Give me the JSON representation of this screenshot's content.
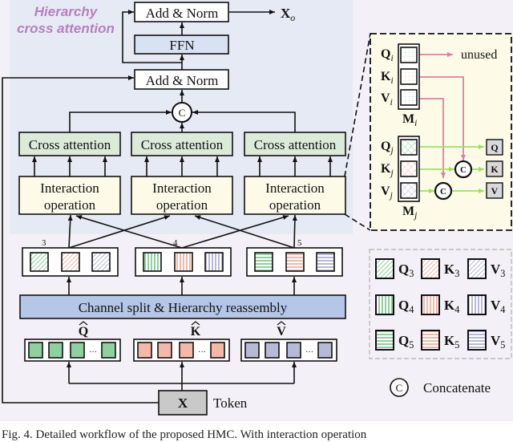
{
  "title": [
    "Hierarchy",
    "cross attention"
  ],
  "colors": {
    "title": "#b77fc0",
    "panel": "#e6eaf4",
    "background": "#f3f0f7",
    "ffn": "#d9e2f3",
    "cross_attention": "#dcebd9",
    "interaction": "#fdfbe8",
    "channel_split": "#b4c7e7",
    "q": "#8fd19e",
    "k": "#f4b8a8",
    "v": "#b8b8d8",
    "pink_arrow": "#e07f9c",
    "green_arrow": "#9be35e",
    "token": "#c9c9c9"
  },
  "blocks": {
    "add_norm_top": "Add & Norm",
    "ffn": "FFN",
    "add_norm": "Add & Norm",
    "concat_symbol": "C",
    "output": "X",
    "output_sub": "o",
    "cross_attention": [
      "Cross attention",
      "Cross attention",
      "Cross attention"
    ],
    "interaction": [
      [
        "Interaction",
        "operation"
      ],
      [
        "Interaction",
        "operation"
      ],
      [
        "Interaction",
        "operation"
      ]
    ],
    "m_labels": [
      {
        "m": "M",
        "s": "3"
      },
      {
        "m": "M",
        "s": "4"
      },
      {
        "m": "M",
        "s": "5"
      }
    ],
    "channel_split": "Channel split & Hierarchy reassembly",
    "hats": [
      "Q",
      "K",
      "V"
    ],
    "dots": "···",
    "token_box": "X",
    "token_label": "Token"
  },
  "detail": {
    "mi_rows": [
      {
        "l": "Q",
        "s": "i"
      },
      {
        "l": "K",
        "s": "i"
      },
      {
        "l": "V",
        "s": "i"
      }
    ],
    "mi_label": {
      "l": "M",
      "s": "i"
    },
    "mj_rows": [
      {
        "l": "Q",
        "s": "j"
      },
      {
        "l": "K",
        "s": "j"
      },
      {
        "l": "V",
        "s": "j"
      }
    ],
    "mj_label": {
      "l": "M",
      "s": "j"
    },
    "unused": "unused",
    "outputs": [
      "Q",
      "K",
      "V"
    ],
    "concat_symbol": "C"
  },
  "legend": {
    "rows": [
      [
        {
          "l": "Q",
          "s": "3"
        },
        {
          "l": "K",
          "s": "3"
        },
        {
          "l": "V",
          "s": "3"
        }
      ],
      [
        {
          "l": "Q",
          "s": "4"
        },
        {
          "l": "K",
          "s": "4"
        },
        {
          "l": "V",
          "s": "4"
        }
      ],
      [
        {
          "l": "Q",
          "s": "5"
        },
        {
          "l": "K",
          "s": "5"
        },
        {
          "l": "V",
          "s": "5"
        }
      ]
    ],
    "concat_symbol": "C",
    "concat_label": "Concatenate"
  },
  "caption": "Fig. 4.  Detailed workflow of the proposed HMC. With interaction operation"
}
